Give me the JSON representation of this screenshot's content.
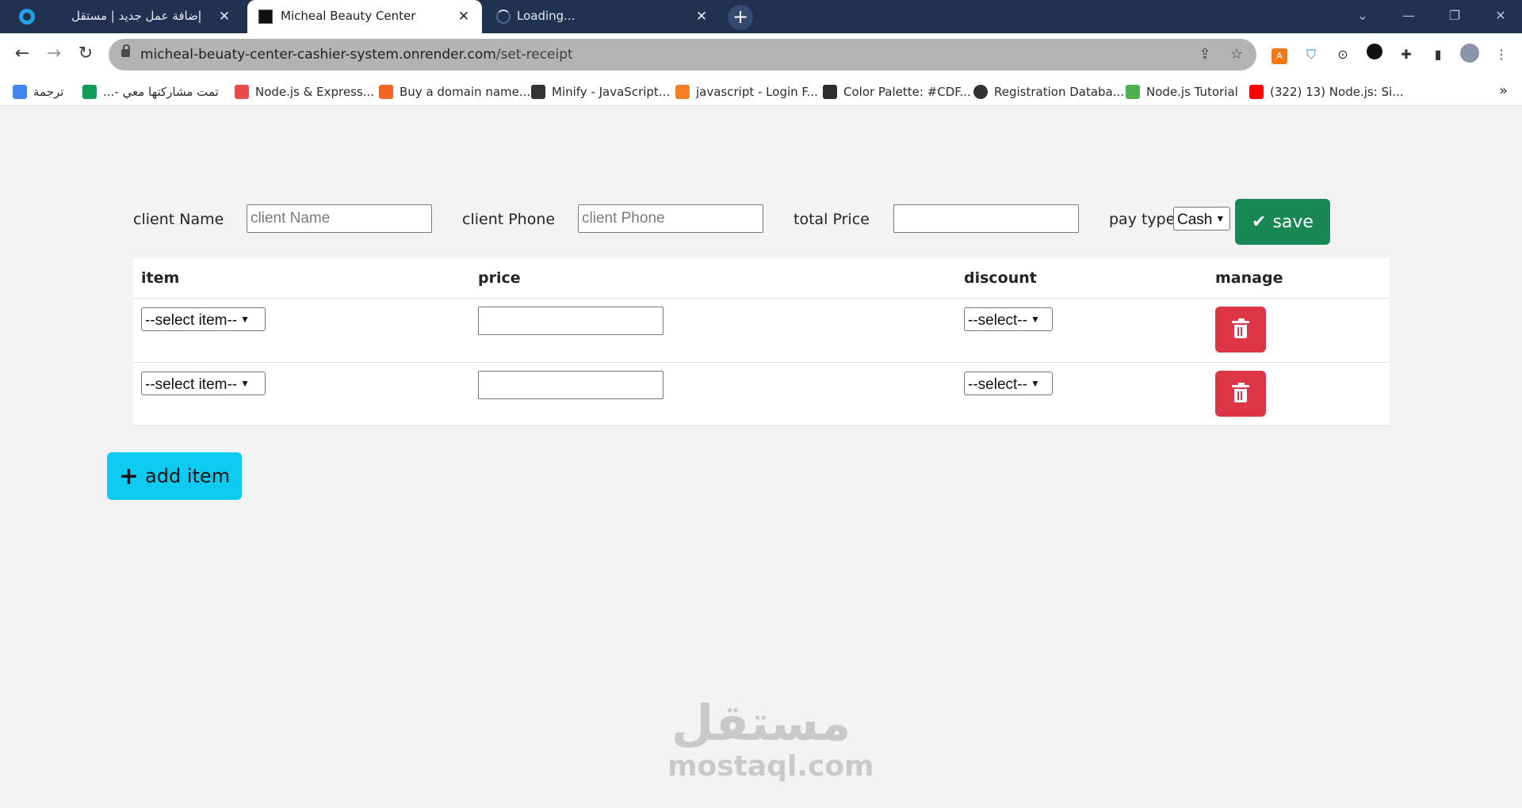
{
  "browser": {
    "tabs": [
      {
        "title": "إضافة عمل جديد | مستقل",
        "close": "✕"
      },
      {
        "title": "Micheal Beauty Center",
        "close": "✕"
      },
      {
        "title": "Loading...",
        "close": "✕"
      }
    ],
    "new_tab": "+",
    "url_domain": "micheal-beuaty-center-cashier-system.onrender.com",
    "url_path": "/set-receipt",
    "bookmarks": [
      {
        "label": "ترجمة",
        "color": "#4285f4"
      },
      {
        "label": "تمت مشاركتها معي -...",
        "color": "#0f9d58"
      },
      {
        "label": "Node.js & Express...",
        "color": "#e94b4b"
      },
      {
        "label": "Buy a domain name...",
        "color": "#f26522"
      },
      {
        "label": "Minify - JavaScript...",
        "color": "#333333"
      },
      {
        "label": "javascript - Login F...",
        "color": "#f48024"
      },
      {
        "label": "Color Palette: #CDF...",
        "color": "#2c2c2c"
      },
      {
        "label": "Registration Databa...",
        "color": "#333333"
      },
      {
        "label": "Node.js Tutorial",
        "color": "#4caf50"
      },
      {
        "label": "(322) 13) Node.js: Si...",
        "color": "#ff0000"
      }
    ]
  },
  "form": {
    "client_name_label": "client Name",
    "client_name_placeholder": "client Name",
    "client_phone_label": "client Phone",
    "client_phone_placeholder": "client Phone",
    "total_price_label": "total Price",
    "total_price_value": "",
    "pay_type_label": "pay type",
    "pay_type_value": "Cash",
    "save_label": "save"
  },
  "table": {
    "headers": [
      "item",
      "price",
      "discount",
      "manage"
    ],
    "rows": [
      {
        "item": "--select item--",
        "price": "",
        "discount": "--select--"
      },
      {
        "item": "--select item--",
        "price": "",
        "discount": "--select--"
      }
    ]
  },
  "add_item_label": "add item",
  "watermark": {
    "arabic": "مستقل",
    "latin": "mostaql.com"
  }
}
